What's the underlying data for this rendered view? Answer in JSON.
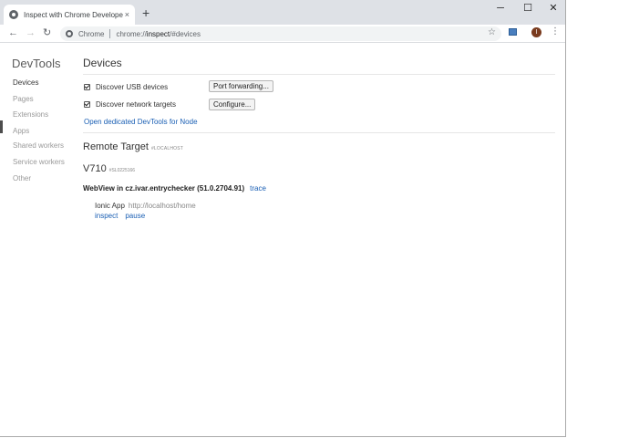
{
  "tab": {
    "title": "Inspect with Chrome Developer T",
    "close": "×",
    "new_tab": "+"
  },
  "window_controls": {
    "minimize": "─",
    "maximize": "☐",
    "close": "✕"
  },
  "toolbar": {
    "back": "←",
    "forward": "→",
    "reload": "↻",
    "chip": "Chrome",
    "url_scheme": "chrome://",
    "url_host": "inspect",
    "url_rest": "/#devices",
    "star": "☆",
    "avatar": "I",
    "menu": "⋮"
  },
  "sidebar": {
    "title": "DevTools",
    "items": [
      "Devices",
      "Pages",
      "Extensions",
      "Apps",
      "Shared workers",
      "Service workers",
      "Other"
    ],
    "active_index": 0
  },
  "devices": {
    "heading": "Devices",
    "discover_usb": {
      "label": "Discover USB devices",
      "checked": true,
      "button": "Port forwarding..."
    },
    "discover_network": {
      "label": "Discover network targets",
      "checked": true,
      "button": "Configure..."
    },
    "node_link": "Open dedicated DevTools for Node"
  },
  "remote": {
    "heading": "Remote Target",
    "host": "#LOCALHOST",
    "device_name": "V710",
    "serial": "#SL0225166",
    "webview": "WebView in cz.ivar.entrychecker (51.0.2704.91)",
    "trace": "trace",
    "target_name": "Ionic App",
    "target_url": "http://localhost/home",
    "inspect": "inspect",
    "pause": "pause"
  }
}
